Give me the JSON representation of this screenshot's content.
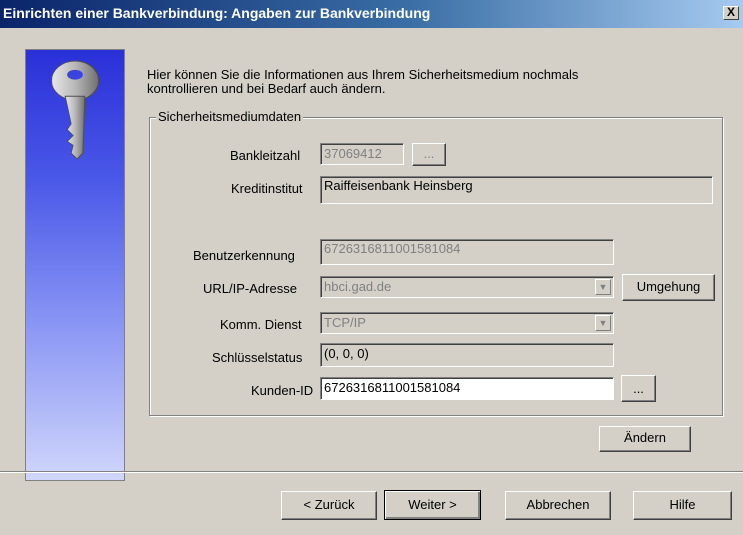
{
  "window": {
    "title": "Einrichten einer Bankverbindung: Angaben zur Bankverbindung",
    "close_label": "X"
  },
  "intro_line1": "Hier können Sie die Informationen aus Ihrem Sicherheitsmedium nochmals",
  "intro_line2": "kontrollieren und bei Bedarf auch ändern.",
  "group": {
    "title": "Sicherheitsmediumdaten",
    "bankleitzahl": {
      "label": "Bankleitzahl",
      "value": "37069412",
      "browse": "..."
    },
    "kreditinstitut": {
      "label": "Kreditinstitut",
      "value": "Raiffeisenbank Heinsberg"
    },
    "benutzerkennung": {
      "label": "Benutzerkennung",
      "value": "6726316811001581084"
    },
    "url": {
      "label": "URL/IP-Adresse",
      "value": "hbci.gad.de",
      "button": "Umgehung"
    },
    "komm": {
      "label": "Komm. Dienst",
      "value": "TCP/IP"
    },
    "schluessel": {
      "label": "Schlüsselstatus",
      "value": "(0, 0, 0)"
    },
    "kunden": {
      "label": "Kunden-ID",
      "value": "6726316811001581084",
      "browse": "..."
    }
  },
  "buttons": {
    "aendern": "Ändern",
    "back": "< Zurück",
    "next": "Weiter >",
    "cancel": "Abbrechen",
    "help": "Hilfe"
  },
  "icons": {
    "combo_arrow": "chevron-down-icon",
    "illustration": "key-icon"
  }
}
